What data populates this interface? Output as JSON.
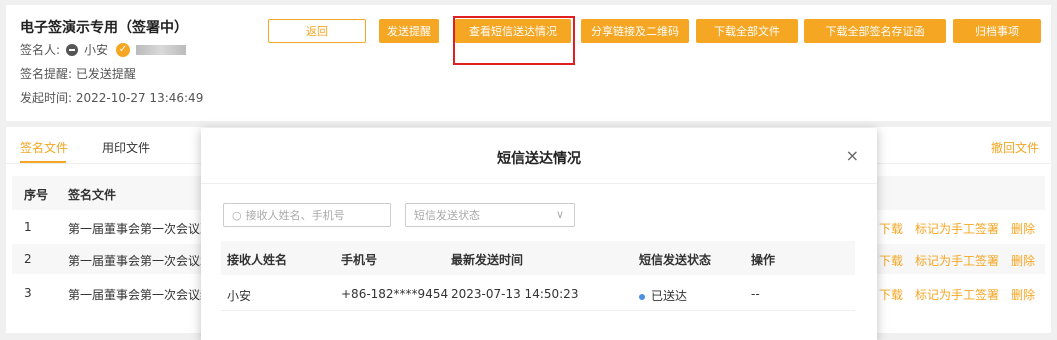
{
  "header": {
    "title": "电子签演示专用（签署中）",
    "signer_label": "签名人:",
    "signer_name": "小安",
    "reminder_label": "签名提醒:",
    "reminder_value": "已发送提醒",
    "start_label": "发起时间:",
    "start_value": "2022-10-27 13:46:49"
  },
  "toolbar": {
    "back": "返回",
    "send_reminder": "发送提醒",
    "view_sms": "查看短信送达情况",
    "share_link": "分享链接及二维码",
    "download_all": "下载全部文件",
    "download_certs": "下载全部签名存证函",
    "archive": "归档事项"
  },
  "tabs": [
    "签名文件",
    "用印文件"
  ],
  "revoke_label": "撤回文件",
  "doc_table": {
    "headers": [
      "序号",
      "签名文件"
    ],
    "rows": [
      {
        "index": "1",
        "name": "第一届董事会第一次会议决"
      },
      {
        "index": "2",
        "name": "第一届董事会第一次会议承"
      },
      {
        "index": "3",
        "name": "第一届董事会第一次会议纪"
      }
    ],
    "actions": [
      "下载",
      "标记为手工签署",
      "删除"
    ]
  },
  "modal": {
    "title": "短信送达情况",
    "search_placeholder": "接收人姓名、手机号",
    "status_placeholder": "短信发送状态",
    "headers": [
      "接收人姓名",
      "手机号",
      "最新发送时间",
      "短信发送状态",
      "操作"
    ],
    "rows": [
      {
        "name": "小安",
        "phone": "+86-182****9454",
        "time": "2023-07-13 14:50:23",
        "status": "已送达",
        "action": "--"
      }
    ]
  },
  "colors": {
    "accent": "#f5a623",
    "highlight": "#e02020",
    "status_delivered": "#4a90e2"
  },
  "icons": {
    "search": "search-icon",
    "close": "close-icon",
    "chevron": "chevron-down-icon",
    "verified": "check-circle-icon"
  }
}
